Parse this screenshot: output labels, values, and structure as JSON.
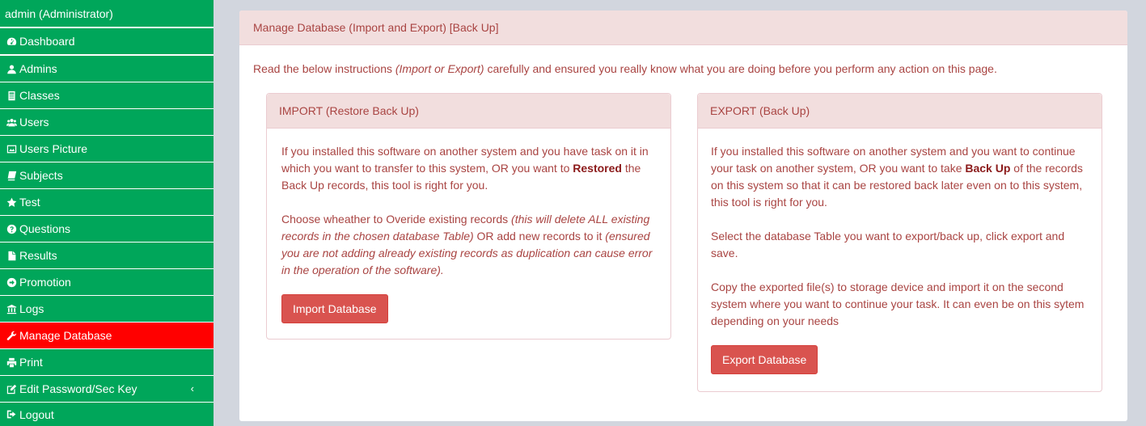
{
  "sidebar": {
    "user": "admin (Administrator)",
    "items": [
      {
        "label": "Dashboard",
        "icon": "dashboard-icon"
      },
      {
        "label": "Admins",
        "icon": "user-icon"
      },
      {
        "label": "Classes",
        "icon": "classes-icon"
      },
      {
        "label": "Users",
        "icon": "users-icon"
      },
      {
        "label": "Users Picture",
        "icon": "picture-icon"
      },
      {
        "label": "Subjects",
        "icon": "book-icon"
      },
      {
        "label": "Test",
        "icon": "star-icon"
      },
      {
        "label": "Questions",
        "icon": "question-icon"
      },
      {
        "label": "Results",
        "icon": "file-icon"
      },
      {
        "label": "Promotion",
        "icon": "arrow-circle-icon"
      },
      {
        "label": "Logs",
        "icon": "bank-icon"
      },
      {
        "label": "Manage Database",
        "icon": "wrench-icon",
        "active": true
      },
      {
        "label": "Print",
        "icon": "print-icon"
      },
      {
        "label": "Edit Password/Sec Key",
        "icon": "edit-icon",
        "chevron": "‹"
      },
      {
        "label": "Logout",
        "icon": "sign-out-icon"
      }
    ]
  },
  "panel": {
    "title": "Manage Database (Import and Export) [Back Up]",
    "intro": {
      "before": "Read the below instructions ",
      "em": "(Import or Export)",
      "after": " carefully and ensured you really know what you are doing before you perform any action on this page."
    }
  },
  "import": {
    "title": "IMPORT (Restore Back Up)",
    "p1_a": "If you installed this software on another system and you have task on it in which you want to transfer to this system, OR you want to ",
    "p1_strong": "Restored",
    "p1_b": " the Back Up records, this tool is right for you.",
    "p2_a": "Choose wheather to Overide existing records ",
    "p2_em1": "(this will delete ALL existing records in the chosen database Table)",
    "p2_b": " OR add new records to it ",
    "p2_em2": "(ensured you are not adding already existing records as duplication can cause error in the operation of the software).",
    "button": "Import Database"
  },
  "export": {
    "title": "EXPORT (Back Up)",
    "p1_a": "If you installed this software on another system and you want to continue your task on another system, OR you want to take ",
    "p1_strong": "Back Up",
    "p1_b": " of the records on this system so that it can be restored back later even on to this system, this tool is right for you.",
    "p2": "Select the database Table you want to export/back up, click export and save.",
    "p3": "Copy the exported file(s) to storage device and import it on the second system where you want to continue your task. It can even be on this sytem depending on your needs",
    "button": "Export Database"
  },
  "colors": {
    "sidebar_green": "#00a65a",
    "active_red": "#ff0000",
    "danger_text": "#a94442",
    "danger_bg": "#f2dede",
    "button_red": "#d9534f"
  }
}
